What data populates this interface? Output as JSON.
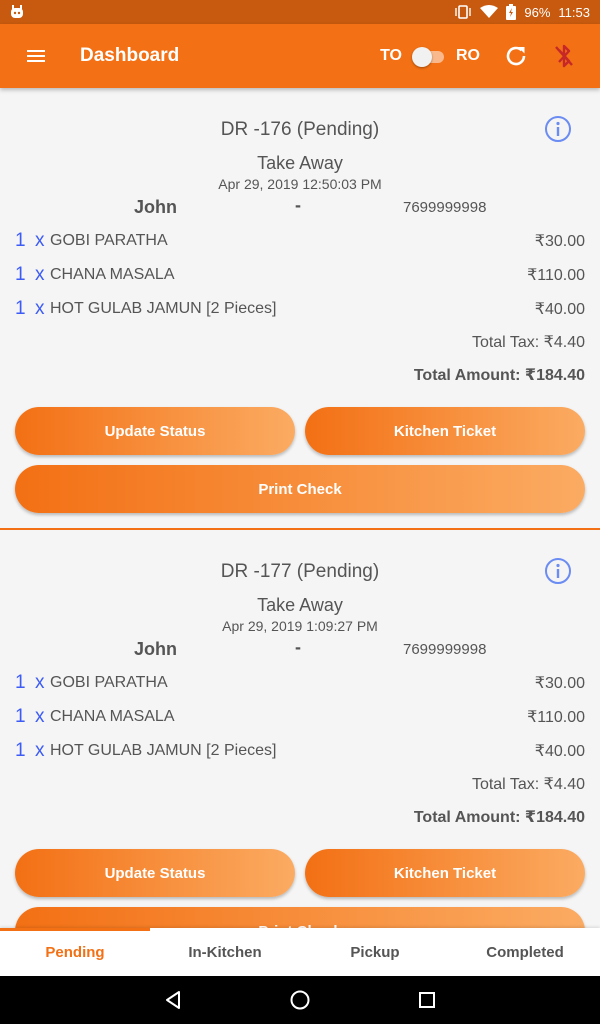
{
  "status_bar": {
    "battery": "96%",
    "time": "11:53"
  },
  "app_bar": {
    "title": "Dashboard",
    "toggle_left_label": "TO",
    "toggle_right_label": "RO"
  },
  "orders": [
    {
      "id": "DR -176 (Pending)",
      "type": "Take Away",
      "date": "Apr 29, 2019 12:50:03 PM",
      "customer_name": "John",
      "separator": "-",
      "phone": "7699999998",
      "items": [
        {
          "qty": "1",
          "x": "x",
          "name": "GOBI PARATHA",
          "price": "₹30.00"
        },
        {
          "qty": "1",
          "x": "x",
          "name": "CHANA MASALA",
          "price": "₹110.00"
        },
        {
          "qty": "1",
          "x": "x",
          "name": "HOT GULAB JAMUN [2 Pieces]",
          "price": "₹40.00"
        }
      ],
      "total_tax": "Total Tax: ₹4.40",
      "total_amount": "Total Amount: ₹184.40",
      "update_status_label": "Update Status",
      "kitchen_ticket_label": "Kitchen Ticket",
      "print_check_label": "Print Check"
    },
    {
      "id": "DR -177 (Pending)",
      "type": "Take Away",
      "date": "Apr 29, 2019 1:09:27 PM",
      "customer_name": "John",
      "separator": "-",
      "phone": "7699999998",
      "items": [
        {
          "qty": "1",
          "x": "x",
          "name": "GOBI PARATHA",
          "price": "₹30.00"
        },
        {
          "qty": "1",
          "x": "x",
          "name": "CHANA MASALA",
          "price": "₹110.00"
        },
        {
          "qty": "1",
          "x": "x",
          "name": "HOT GULAB JAMUN [2 Pieces]",
          "price": "₹40.00"
        }
      ],
      "total_tax": "Total Tax: ₹4.40",
      "total_amount": "Total Amount: ₹184.40",
      "update_status_label": "Update Status",
      "kitchen_ticket_label": "Kitchen Ticket",
      "print_check_label": "Print Check"
    }
  ],
  "tabs": [
    {
      "label": "Pending",
      "active": true
    },
    {
      "label": "In-Kitchen",
      "active": false
    },
    {
      "label": "Pickup",
      "active": false
    },
    {
      "label": "Completed",
      "active": false
    }
  ],
  "colors": {
    "primary": "#f37014",
    "status_bar": "#c75a0e",
    "accent_blue": "#3d5cf5",
    "info_icon": "#6b8cf2"
  },
  "icons": [
    "menu-icon",
    "refresh-icon",
    "bluetooth-disabled-icon",
    "info-icon",
    "back-icon",
    "home-icon",
    "recents-icon"
  ]
}
